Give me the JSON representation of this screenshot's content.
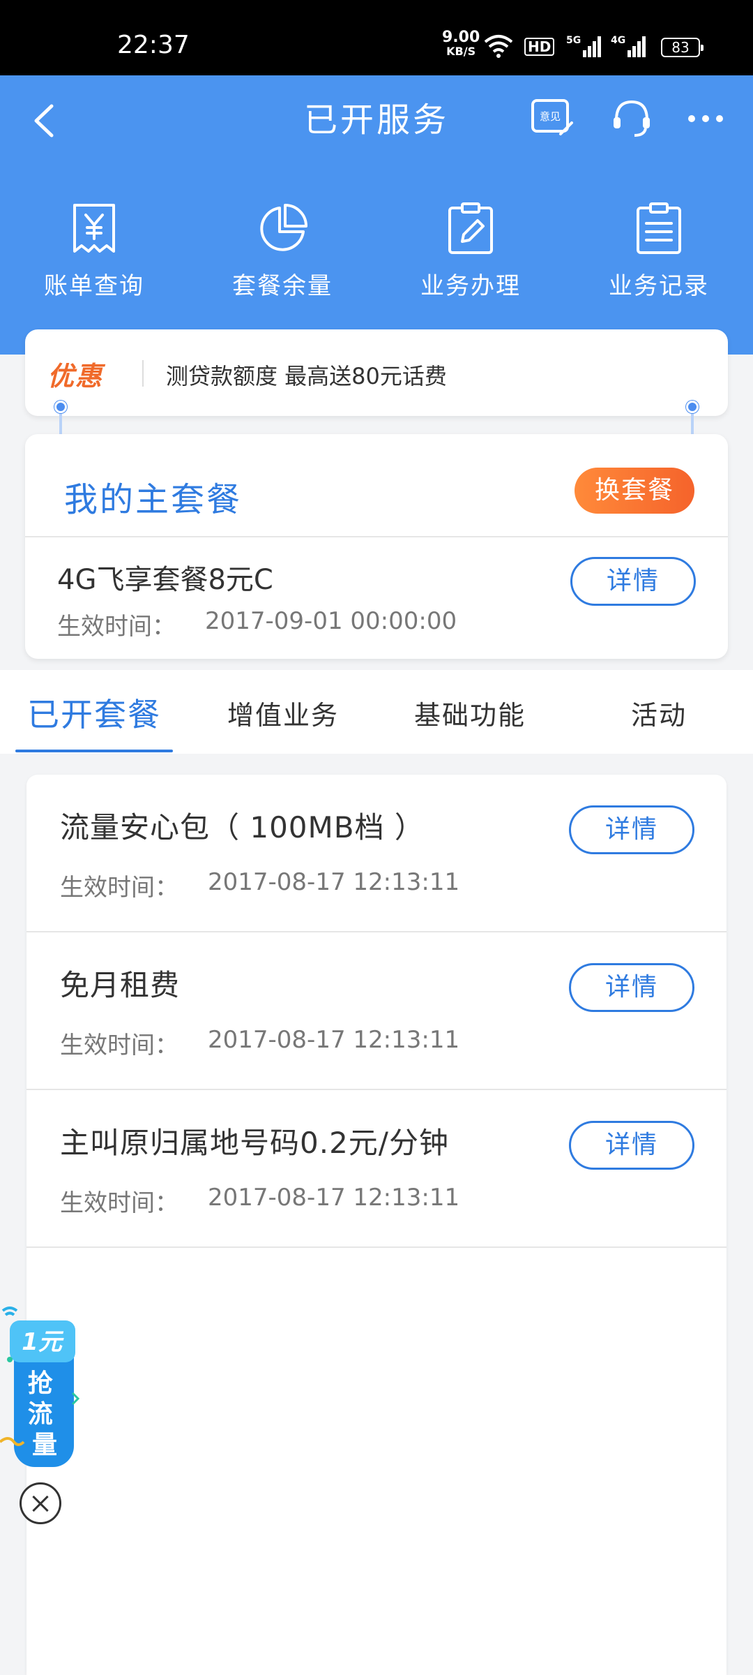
{
  "status_bar": {
    "time": "22:37",
    "speed_value": "9.00",
    "speed_unit": "KB/S",
    "hd_label": "HD",
    "net1": "5G",
    "net2": "4G",
    "battery": "83"
  },
  "header": {
    "title": "已开服务",
    "feedback_icon_text": "意见",
    "quick_actions": [
      {
        "label": "账单查询",
        "icon": "bill-icon"
      },
      {
        "label": "套餐余量",
        "icon": "pie-chart-icon"
      },
      {
        "label": "业务办理",
        "icon": "edit-icon"
      },
      {
        "label": "业务记录",
        "icon": "record-icon"
      }
    ]
  },
  "promo": {
    "tag": "优惠",
    "text": "测贷款额度 最高送80元话费"
  },
  "main_package": {
    "title": "我的主套餐",
    "change_label": "换套餐",
    "name": "4G飞享套餐8元C",
    "effective_label": "生效时间：",
    "effective_date": "2017-09-01  00:00:00",
    "detail_label": "详情"
  },
  "tabs": [
    {
      "label": "已开套餐",
      "active": true
    },
    {
      "label": "增值业务",
      "active": false
    },
    {
      "label": "基础功能",
      "active": false
    },
    {
      "label": "活动",
      "active": false
    }
  ],
  "services": [
    {
      "name": "流量安心包（ 100MB档 ）",
      "effective_label": "生效时间：",
      "effective_date": "2017-08-17  12:13:11",
      "detail_label": "详情"
    },
    {
      "name": "免月租费",
      "effective_label": "生效时间：",
      "effective_date": "2017-08-17  12:13:11",
      "detail_label": "详情"
    },
    {
      "name": "主叫原归属地号码0.2元/分钟",
      "effective_label": "生效时间：",
      "effective_date": "2017-08-17  12:13:11",
      "detail_label": "详情"
    }
  ],
  "float_ad": {
    "price": "1元",
    "text": "抢流量"
  },
  "colors": {
    "primary": "#4b94f0",
    "accent_blue": "#2f7be0",
    "orange": "#f5632b"
  }
}
